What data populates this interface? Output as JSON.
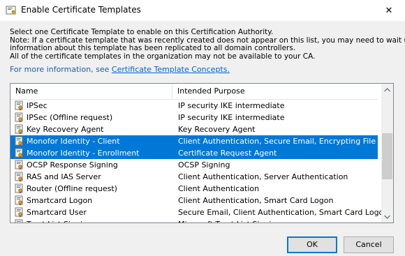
{
  "window": {
    "title": "Enable Certificate Templates",
    "close_glyph": "✕"
  },
  "intro": {
    "line1": "Select one Certificate Template to enable on this Certification Authority.",
    "line2": "Note: If a certificate template that was recently created does not appear on this list, you may need to wait until",
    "line3": "information about this template has been replicated to all domain controllers.",
    "line4": "All of the certificate templates in the organization may not be available to your CA.",
    "more_prefix": "For more information, see ",
    "more_link": "Certificate Template Concepts."
  },
  "list": {
    "columns": {
      "name": "Name",
      "purpose": "Intended Purpose"
    },
    "rows": [
      {
        "name": "IPSec",
        "purpose": "IP security IKE intermediate",
        "selected": false
      },
      {
        "name": "IPSec (Offline request)",
        "purpose": "IP security IKE intermediate",
        "selected": false
      },
      {
        "name": "Key Recovery Agent",
        "purpose": "Key Recovery Agent",
        "selected": false
      },
      {
        "name": "Monofor Identity - Client",
        "purpose": "Client Authentication, Secure Email, Encrypting File System",
        "selected": true
      },
      {
        "name": "Monofor Identity - Enrollment",
        "purpose": "Certificate Request Agent",
        "selected": true
      },
      {
        "name": "OCSP Response Signing",
        "purpose": "OCSP Signing",
        "selected": false
      },
      {
        "name": "RAS and IAS Server",
        "purpose": "Client Authentication, Server Authentication",
        "selected": false
      },
      {
        "name": "Router (Offline request)",
        "purpose": "Client Authentication",
        "selected": false
      },
      {
        "name": "Smartcard Logon",
        "purpose": "Client Authentication, Smart Card Logon",
        "selected": false
      },
      {
        "name": "Smartcard User",
        "purpose": "Secure Email, Client Authentication, Smart Card Logon",
        "selected": false
      },
      {
        "name": "Trust List Signing",
        "purpose": "Microsoft Trust List Signing",
        "selected": false
      }
    ],
    "row_icon": "certificate-template-icon",
    "scroll_position": 0.55
  },
  "buttons": {
    "ok": "OK",
    "cancel": "Cancel"
  },
  "colors": {
    "selection": "#0078d7",
    "link": "#0066cc"
  }
}
